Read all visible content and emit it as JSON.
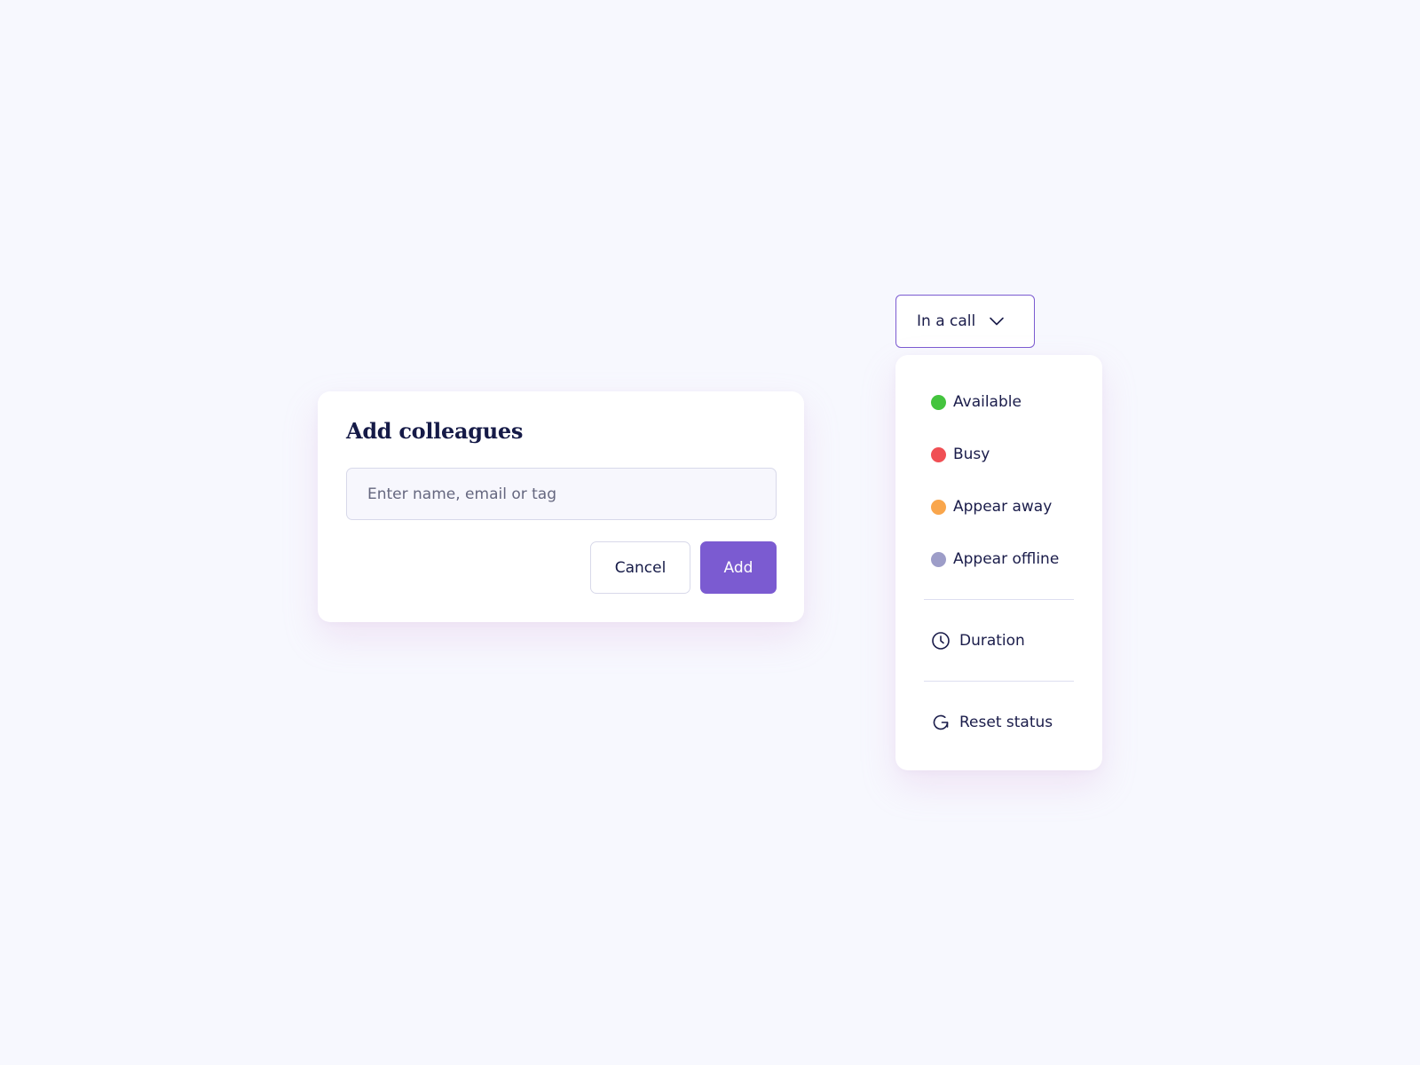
{
  "dialog": {
    "title": "Add colleagues",
    "input_placeholder": "Enter name, email or tag",
    "input_value": "",
    "cancel_label": "Cancel",
    "add_label": "Add"
  },
  "status": {
    "current": "In a call",
    "options": [
      {
        "label": "Available",
        "color": "#44c43e"
      },
      {
        "label": "Busy",
        "color": "#f04f54"
      },
      {
        "label": "Appear away",
        "color": "#f9a64c"
      },
      {
        "label": "Appear offline",
        "color": "#9d9dc8"
      }
    ],
    "duration_label": "Duration",
    "duration_icon": "clock-icon",
    "reset_label": "Reset status",
    "reset_icon": "reset-icon",
    "trigger_icon": "chevron-down-icon"
  },
  "colors": {
    "accent": "#7b5bd1",
    "background": "#f7f8fe",
    "text": "#1a1c4a"
  }
}
